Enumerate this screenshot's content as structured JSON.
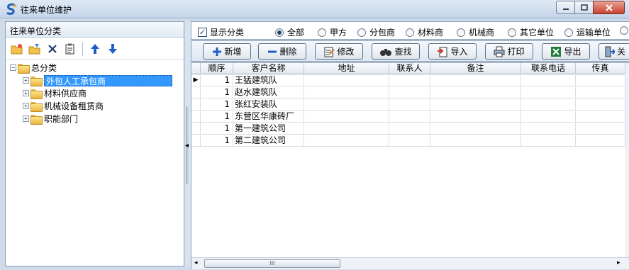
{
  "window": {
    "title": "往来单位维护",
    "app_icon": "s-logo-icon"
  },
  "left_panel": {
    "header": "往来单位分类",
    "toolbar_icons": [
      "add-folder-icon",
      "edit-folder-icon",
      "delete-icon",
      "clipboard-icon",
      "arrow-up-icon",
      "arrow-down-icon"
    ],
    "tree": {
      "root": "总分类",
      "children": [
        "外包人工承包商",
        "材料供应商",
        "机械设备租赁商",
        "职能部门"
      ],
      "selected": "外包人工承包商"
    }
  },
  "filter": {
    "show_category_label": "显示分类",
    "show_category_checked": true,
    "options": [
      "全部",
      "甲方",
      "分包商",
      "材料商",
      "机械商",
      "其它单位",
      "运输单位"
    ],
    "selected": "全部"
  },
  "actions": {
    "add": "新增",
    "delete": "删除",
    "edit": "修改",
    "find": "查找",
    "import": "导入",
    "print": "打印",
    "export": "导出",
    "close": "关"
  },
  "grid": {
    "columns": [
      "顺序",
      "客户名称",
      "地址",
      "联系人",
      "备注",
      "联系电话",
      "传真"
    ],
    "rows": [
      {
        "order": "1",
        "name": "王猛建筑队"
      },
      {
        "order": "1",
        "name": "赵水建筑队"
      },
      {
        "order": "1",
        "name": "张红安装队"
      },
      {
        "order": "1",
        "name": "东营区华康砖厂"
      },
      {
        "order": "1",
        "name": "第一建筑公司"
      },
      {
        "order": "1",
        "name": "第二建筑公司"
      }
    ]
  },
  "scrollbar_grip": "III"
}
